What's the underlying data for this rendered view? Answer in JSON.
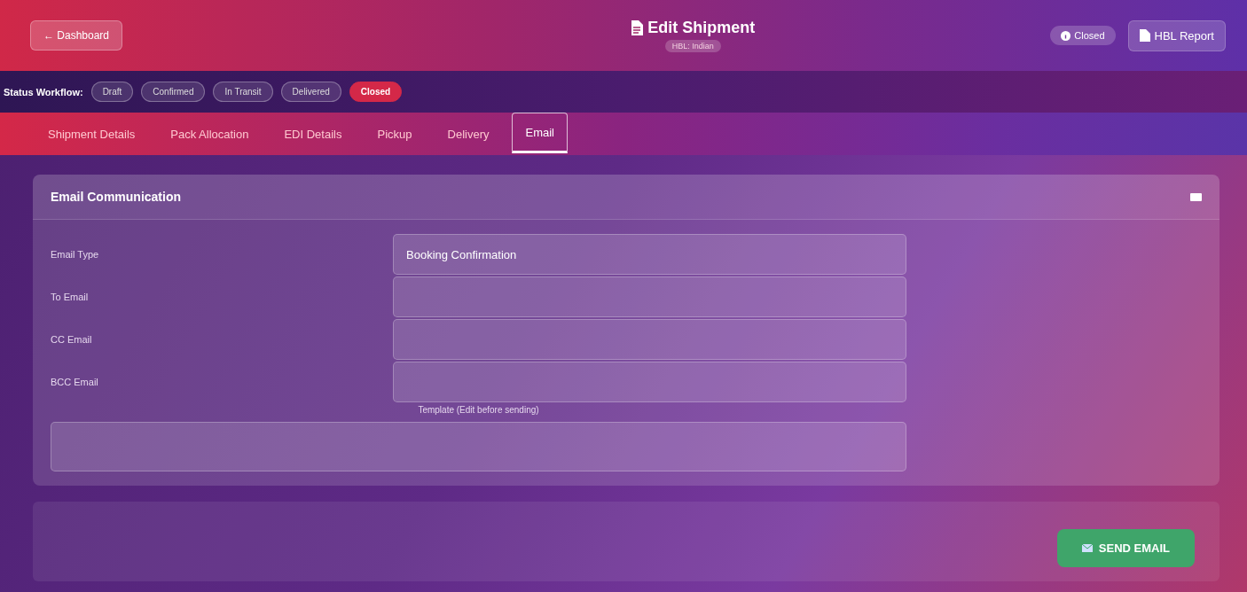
{
  "header": {
    "back_button": "← Dashboard",
    "title": "Edit Shipment",
    "subtitle": "HBL: Indian",
    "status_badge": "Closed",
    "report_button": "HBL Report"
  },
  "workflow": {
    "label": "Status Workflow:",
    "steps": [
      {
        "label": "Draft",
        "selected": false
      },
      {
        "label": "Confirmed",
        "selected": false
      },
      {
        "label": "In Transit",
        "selected": false
      },
      {
        "label": "Delivered",
        "selected": false
      },
      {
        "label": "Closed",
        "selected": true
      }
    ]
  },
  "tabs": [
    {
      "label": "Shipment Details",
      "selected": false
    },
    {
      "label": "Pack Allocation",
      "selected": false
    },
    {
      "label": "EDI Details",
      "selected": false
    },
    {
      "label": "Pickup",
      "selected": false
    },
    {
      "label": "Delivery",
      "selected": false
    },
    {
      "label": "Email",
      "selected": true
    }
  ],
  "email_card": {
    "title": "Email Communication",
    "fields": [
      {
        "label": "Email Type",
        "value": "Booking Confirmation"
      },
      {
        "label": "To Email"
      },
      {
        "label": "CC Email"
      },
      {
        "label": "BCC Email"
      }
    ],
    "template_label": "Template (Edit before sending)"
  },
  "send_button": "SEND EMAIL"
}
